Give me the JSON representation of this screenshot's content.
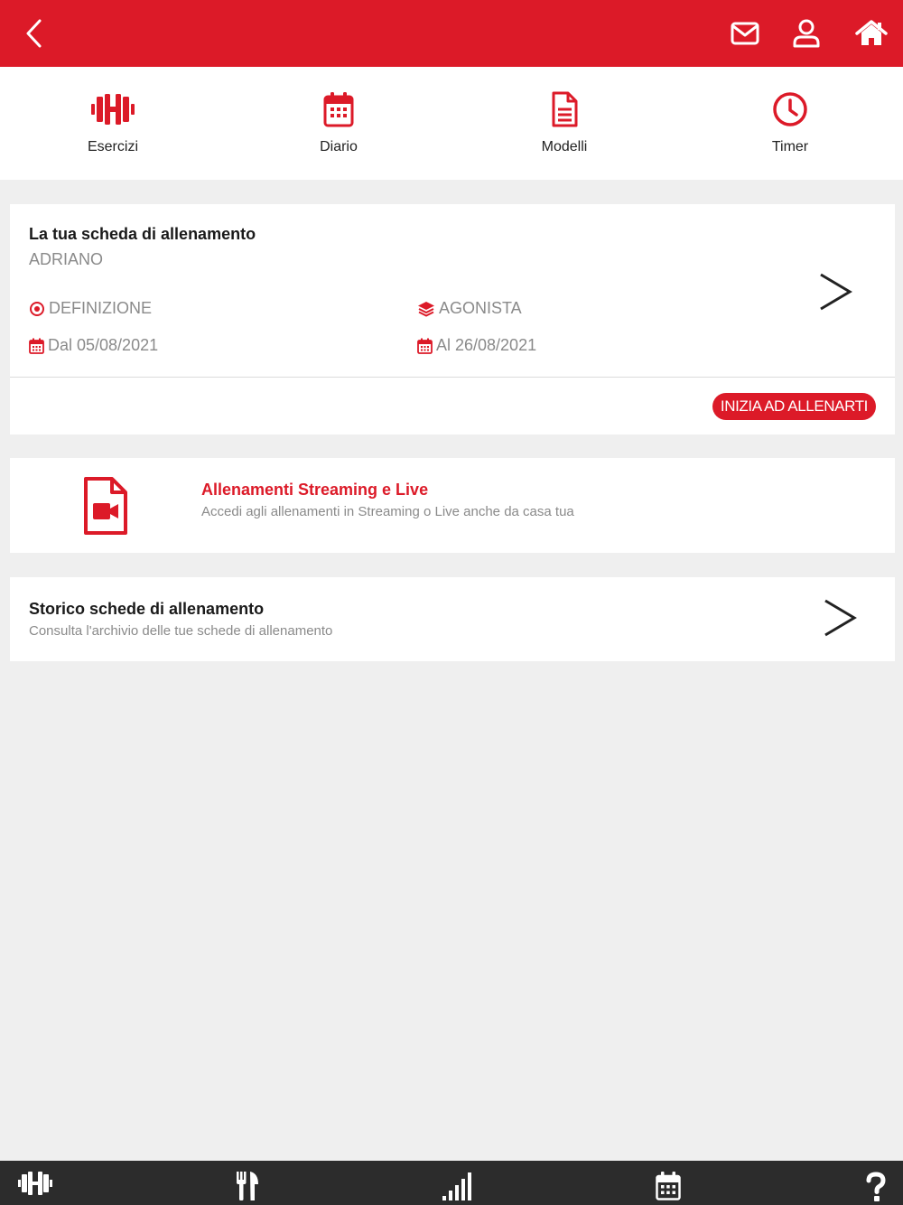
{
  "header": {
    "back_icon": "chevron-left-icon",
    "mail_icon": "envelope-icon",
    "profile_icon": "user-icon",
    "home_icon": "home-icon"
  },
  "quick_nav": [
    {
      "label": "Esercizi",
      "icon": "dumbbell-icon"
    },
    {
      "label": "Diario",
      "icon": "calendar-icon"
    },
    {
      "label": "Modelli",
      "icon": "document-icon"
    },
    {
      "label": "Timer",
      "icon": "clock-icon"
    }
  ],
  "plan_card": {
    "title": "La tua scheda di allenamento",
    "owner": "ADRIANO",
    "goal": "DEFINIZIONE",
    "level": "AGONISTA",
    "start": "Dal 05/08/2021",
    "end": "Al 26/08/2021",
    "cta_label": "INIZIA AD ALLENARTI"
  },
  "streaming_card": {
    "title": "Allenamenti Streaming e Live",
    "subtitle": "Accedi agli allenamenti in Streaming o Live anche da casa tua"
  },
  "history_card": {
    "title": "Storico schede di allenamento",
    "subtitle": "Consulta l'archivio delle tue schede di allenamento"
  },
  "bottom_nav": [
    {
      "icon": "dumbbell-icon"
    },
    {
      "icon": "cutlery-icon"
    },
    {
      "icon": "signal-bars-icon"
    },
    {
      "icon": "calendar-icon"
    },
    {
      "icon": "question-icon"
    }
  ],
  "colors": {
    "brand": "#dc1a28",
    "bottom_bar": "#2c2c2c",
    "background": "#efefef"
  }
}
